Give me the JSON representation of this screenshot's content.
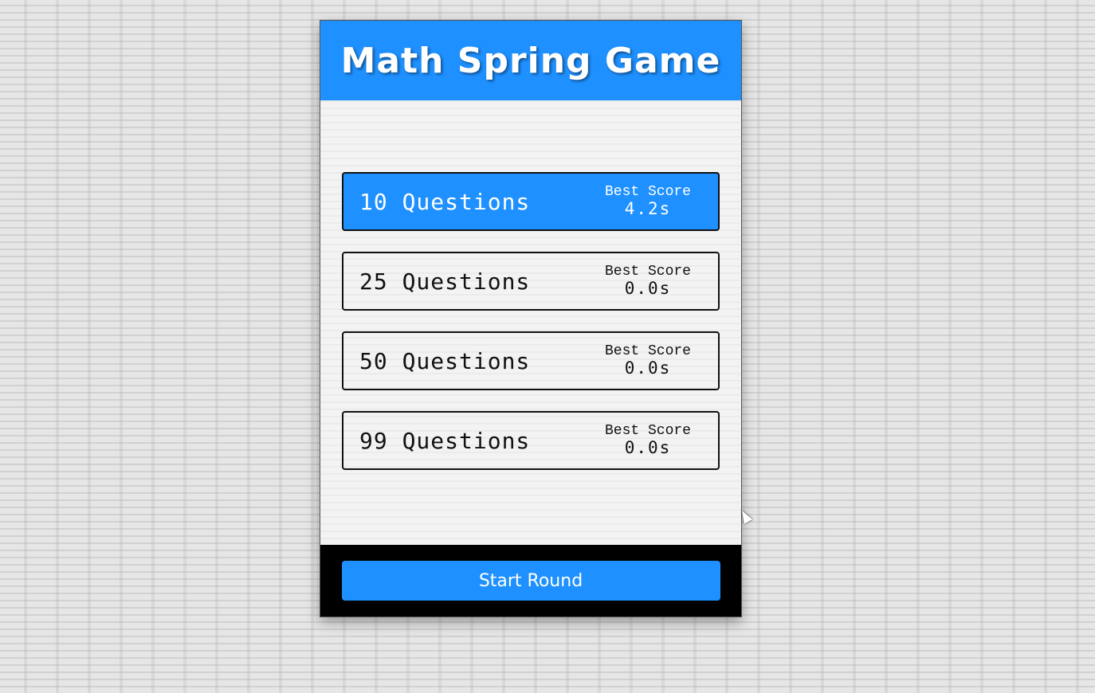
{
  "header": {
    "title": "Math Spring Game"
  },
  "options": [
    {
      "label": "10 Questions",
      "best_score_label": "Best Score",
      "best_score": "4.2s",
      "selected": true
    },
    {
      "label": "25 Questions",
      "best_score_label": "Best Score",
      "best_score": "0.0s",
      "selected": false
    },
    {
      "label": "50 Questions",
      "best_score_label": "Best Score",
      "best_score": "0.0s",
      "selected": false
    },
    {
      "label": "99 Questions",
      "best_score_label": "Best Score",
      "best_score": "0.0s",
      "selected": false
    }
  ],
  "footer": {
    "start_label": "Start Round"
  },
  "colors": {
    "accent": "#1e90ff",
    "footer_bg": "#000000",
    "text": "#111111"
  }
}
